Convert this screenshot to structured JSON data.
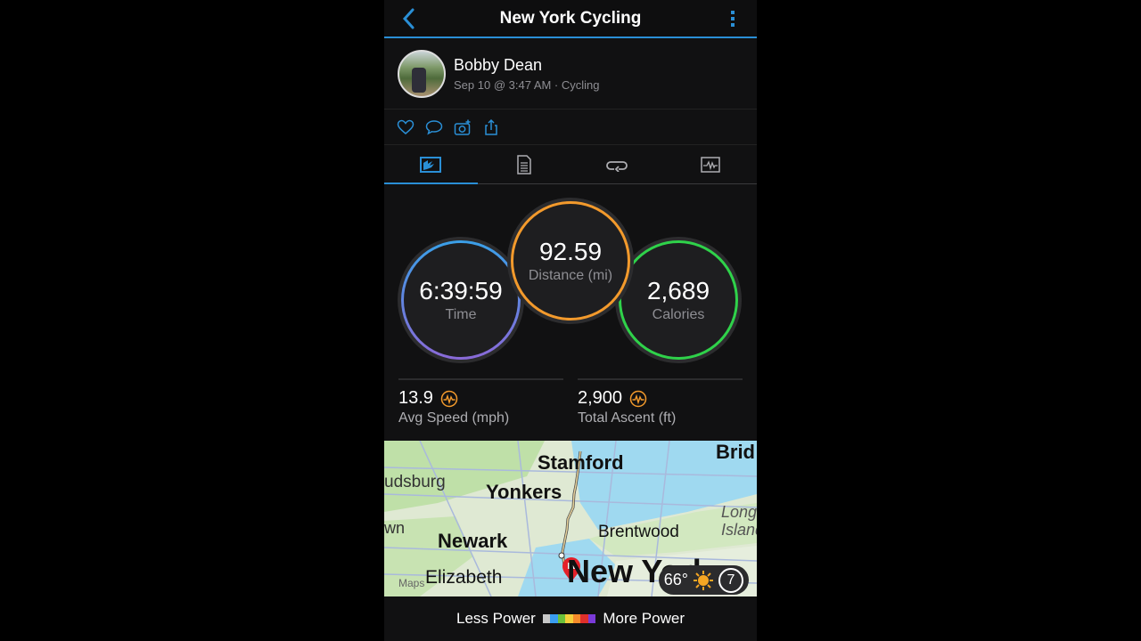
{
  "header": {
    "title": "New York Cycling",
    "back_icon": "chevron-left-icon",
    "more_icon": "vertical-ellipsis-icon"
  },
  "profile": {
    "name": "Bobby Dean",
    "meta": "Sep 10 @ 3:47 AM · Cycling"
  },
  "actions": [
    "like-icon",
    "comment-icon",
    "add-photo-icon",
    "share-icon"
  ],
  "tabs": [
    {
      "name": "overview",
      "icon": "map-overview-icon",
      "active": true
    },
    {
      "name": "stats",
      "icon": "document-list-icon",
      "active": false
    },
    {
      "name": "laps",
      "icon": "laps-loop-icon",
      "active": false
    },
    {
      "name": "charts",
      "icon": "activity-chart-icon",
      "active": false
    }
  ],
  "summary": {
    "time": {
      "value": "6:39:59",
      "label": "Time",
      "color": "#3aa0e8"
    },
    "distance": {
      "value": "92.59",
      "label": "Distance (mi)",
      "color": "#f39a2c"
    },
    "calories": {
      "value": "2,689",
      "label": "Calories",
      "color": "#2fd24a"
    }
  },
  "stats": [
    {
      "value": "13.9",
      "label": "Avg Speed (mph)",
      "icon": "activity-pulse-icon"
    },
    {
      "value": "2,900",
      "label": "Total Ascent (ft)",
      "icon": "activity-pulse-icon"
    }
  ],
  "map": {
    "labels": [
      "Stamford",
      "Yonkers",
      "Newark",
      "Elizabeth",
      "Brentwood",
      "New York",
      "udsburg",
      "wn",
      "Brid",
      "Long Island",
      "Maps"
    ],
    "weather": {
      "temperature": "66°",
      "icon": "sun-icon",
      "aqi": "7"
    }
  },
  "legend": {
    "left": "Less Power",
    "right": "More Power",
    "colors": [
      "#c8c8c8",
      "#3a9df0",
      "#6cc13a",
      "#f5cf3a",
      "#f68b2a",
      "#e0302a",
      "#7a3ad8"
    ]
  }
}
